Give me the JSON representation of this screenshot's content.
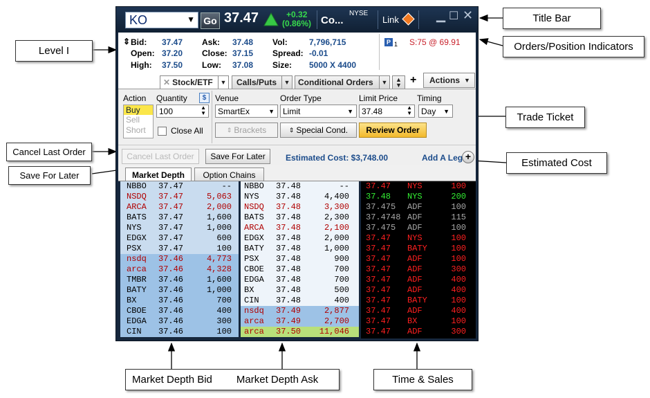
{
  "title_bar": {
    "symbol": "KO",
    "go_label": "Go",
    "last_price": "37.47",
    "change": "+0.32",
    "change_pct": "(0.86%)",
    "company": "Co...",
    "exchange": "NYSE",
    "link_label": "Link",
    "up_color": "#37d94c"
  },
  "level1": {
    "bid_label": "Bid:",
    "bid": "37.47",
    "ask_label": "Ask:",
    "ask": "37.48",
    "vol_label": "Vol:",
    "vol": "7,796,715",
    "open_label": "Open:",
    "open": "37.20",
    "close_label": "Close:",
    "close": "37.15",
    "spread_label": "Spread:",
    "spread": "-0.01",
    "high_label": "High:",
    "high": "37.50",
    "low_label": "Low:",
    "low": "37.08",
    "size_label": "Size:",
    "size": "5000 X 4400"
  },
  "position": {
    "badge": "P",
    "count": "1",
    "info": "S:75 @ 69.91"
  },
  "tabs": {
    "stock": "Stock/ETF",
    "calls": "Calls/Puts",
    "conditional": "Conditional Orders",
    "plus": "+",
    "actions": "Actions"
  },
  "ticket": {
    "action_label": "Action",
    "actions": [
      "Buy",
      "Sell",
      "Short"
    ],
    "quantity_label": "Quantity",
    "quantity": "100",
    "dollar": "$",
    "venue_label": "Venue",
    "venue": "SmartEx",
    "order_type_label": "Order Type",
    "order_type": "Limit",
    "limit_label": "Limit Price",
    "limit": "37.48",
    "timing_label": "Timing",
    "timing": "Day",
    "close_all": "Close All",
    "brackets": "Brackets",
    "special": "Special Cond.",
    "review": "Review Order",
    "cancel_last": "Cancel Last Order",
    "save_later": "Save For Later",
    "est_cost": "Estimated Cost: $3,748.00",
    "add_leg": "Add A Leg"
  },
  "depth_tabs": {
    "market_depth": "Market Depth",
    "option_chains": "Option Chains"
  },
  "depth_bid": [
    {
      "mm": "NBBO",
      "price": "37.47",
      "size": "--",
      "color": "#000000",
      "bg": "#c9dcef"
    },
    {
      "mm": "NSDQ",
      "price": "37.47",
      "size": "5,063",
      "color": "#b00000",
      "bg": "#c9dcef"
    },
    {
      "mm": "ARCA",
      "price": "37.47",
      "size": "2,000",
      "color": "#b00000",
      "bg": "#c9dcef"
    },
    {
      "mm": "BATS",
      "price": "37.47",
      "size": "1,600",
      "color": "#000000",
      "bg": "#c9dcef"
    },
    {
      "mm": "NYS",
      "price": "37.47",
      "size": "1,000",
      "color": "#000000",
      "bg": "#c9dcef"
    },
    {
      "mm": "EDGX",
      "price": "37.47",
      "size": "600",
      "color": "#000000",
      "bg": "#c9dcef"
    },
    {
      "mm": "PSX",
      "price": "37.47",
      "size": "100",
      "color": "#000000",
      "bg": "#c9dcef"
    },
    {
      "mm": "nsdq",
      "price": "37.46",
      "size": "4,773",
      "color": "#b00000",
      "bg": "#9dc2e6"
    },
    {
      "mm": "arca",
      "price": "37.46",
      "size": "4,328",
      "color": "#b00000",
      "bg": "#9dc2e6"
    },
    {
      "mm": "TMBR",
      "price": "37.46",
      "size": "1,600",
      "color": "#000000",
      "bg": "#9dc2e6"
    },
    {
      "mm": "BATY",
      "price": "37.46",
      "size": "1,000",
      "color": "#000000",
      "bg": "#9dc2e6"
    },
    {
      "mm": "BX",
      "price": "37.46",
      "size": "700",
      "color": "#000000",
      "bg": "#9dc2e6"
    },
    {
      "mm": "CBOE",
      "price": "37.46",
      "size": "400",
      "color": "#000000",
      "bg": "#9dc2e6"
    },
    {
      "mm": "EDGA",
      "price": "37.46",
      "size": "300",
      "color": "#000000",
      "bg": "#9dc2e6"
    },
    {
      "mm": "CIN",
      "price": "37.46",
      "size": "100",
      "color": "#000000",
      "bg": "#9dc2e6"
    }
  ],
  "depth_ask": [
    {
      "mm": "NBBO",
      "price": "37.48",
      "size": "--",
      "color": "#000000",
      "bg": "#eef4fa"
    },
    {
      "mm": "NYS",
      "price": "37.48",
      "size": "4,400",
      "color": "#000000",
      "bg": "#eef4fa"
    },
    {
      "mm": "NSDQ",
      "price": "37.48",
      "size": "3,300",
      "color": "#b00000",
      "bg": "#eef4fa"
    },
    {
      "mm": "BATS",
      "price": "37.48",
      "size": "2,300",
      "color": "#000000",
      "bg": "#eef4fa"
    },
    {
      "mm": "ARCA",
      "price": "37.48",
      "size": "2,100",
      "color": "#b00000",
      "bg": "#eef4fa"
    },
    {
      "mm": "EDGX",
      "price": "37.48",
      "size": "2,000",
      "color": "#000000",
      "bg": "#eef4fa"
    },
    {
      "mm": "BATY",
      "price": "37.48",
      "size": "1,000",
      "color": "#000000",
      "bg": "#eef4fa"
    },
    {
      "mm": "PSX",
      "price": "37.48",
      "size": "900",
      "color": "#000000",
      "bg": "#eef4fa"
    },
    {
      "mm": "CBOE",
      "price": "37.48",
      "size": "700",
      "color": "#000000",
      "bg": "#eef4fa"
    },
    {
      "mm": "EDGA",
      "price": "37.48",
      "size": "700",
      "color": "#000000",
      "bg": "#eef4fa"
    },
    {
      "mm": "BX",
      "price": "37.48",
      "size": "500",
      "color": "#000000",
      "bg": "#eef4fa"
    },
    {
      "mm": "CIN",
      "price": "37.48",
      "size": "400",
      "color": "#000000",
      "bg": "#eef4fa"
    },
    {
      "mm": "nsdq",
      "price": "37.49",
      "size": "2,877",
      "color": "#b00000",
      "bg": "#9dc2e6"
    },
    {
      "mm": "arca",
      "price": "37.49",
      "size": "2,700",
      "color": "#b00000",
      "bg": "#9dc2e6"
    },
    {
      "mm": "arca",
      "price": "37.50",
      "size": "11,046",
      "color": "#b00000",
      "bg": "#b9e07a"
    }
  ],
  "time_sales": [
    {
      "price": "37.47",
      "ex": "NYS",
      "size": "100",
      "color": "#ff2020"
    },
    {
      "price": "37.48",
      "ex": "NYS",
      "size": "200",
      "color": "#33ee33"
    },
    {
      "price": "37.475",
      "ex": "ADF",
      "size": "100",
      "color": "#a8a8a8"
    },
    {
      "price": "37.4748",
      "ex": "ADF",
      "size": "115",
      "color": "#a8a8a8"
    },
    {
      "price": "37.475",
      "ex": "ADF",
      "size": "100",
      "color": "#a8a8a8"
    },
    {
      "price": "37.47",
      "ex": "NYS",
      "size": "100",
      "color": "#ff2020"
    },
    {
      "price": "37.47",
      "ex": "BATY",
      "size": "100",
      "color": "#ff2020"
    },
    {
      "price": "37.47",
      "ex": "ADF",
      "size": "100",
      "color": "#ff2020"
    },
    {
      "price": "37.47",
      "ex": "ADF",
      "size": "300",
      "color": "#ff2020"
    },
    {
      "price": "37.47",
      "ex": "ADF",
      "size": "400",
      "color": "#ff2020"
    },
    {
      "price": "37.47",
      "ex": "ADF",
      "size": "400",
      "color": "#ff2020"
    },
    {
      "price": "37.47",
      "ex": "BATY",
      "size": "100",
      "color": "#ff2020"
    },
    {
      "price": "37.47",
      "ex": "ADF",
      "size": "400",
      "color": "#ff2020"
    },
    {
      "price": "37.47",
      "ex": "BX",
      "size": "100",
      "color": "#ff2020"
    },
    {
      "price": "37.47",
      "ex": "ADF",
      "size": "300",
      "color": "#ff2020"
    }
  ],
  "callouts": {
    "title_bar": "Title Bar",
    "level1": "Level I",
    "orders_position": "Orders/Position Indicators",
    "trade_ticket": "Trade Ticket",
    "cancel_last": "Cancel Last Order",
    "save_later": "Save For Later",
    "estimated_cost": "Estimated Cost",
    "depth_bid": "Market Depth Bid",
    "depth_ask": "Market Depth Ask",
    "time_sales": "Time & Sales"
  }
}
